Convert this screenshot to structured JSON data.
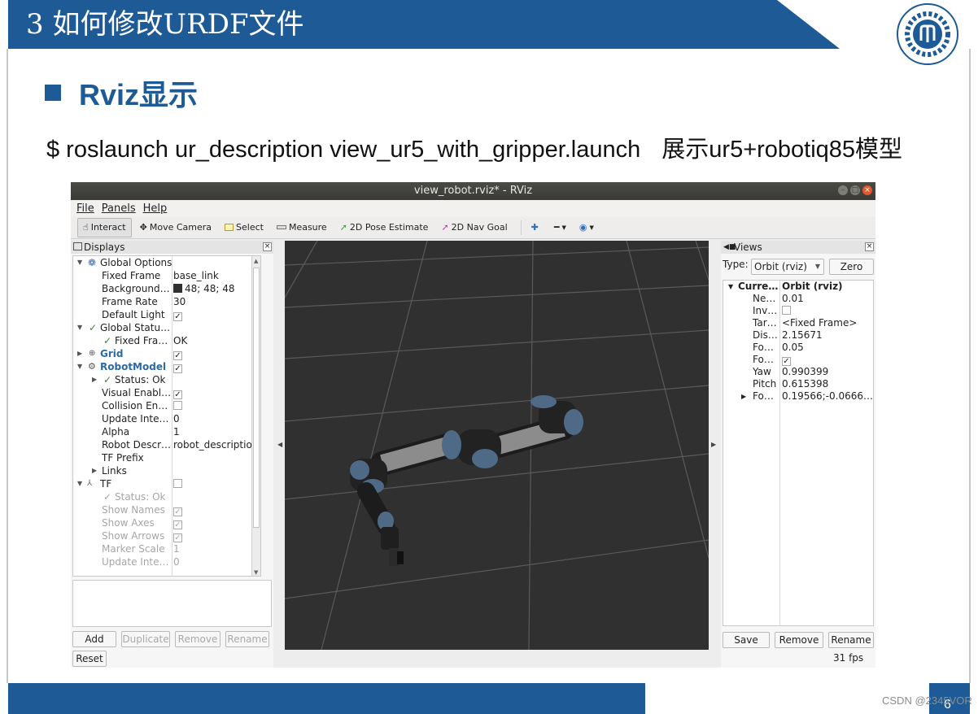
{
  "slide": {
    "title": "3 如何修改URDF文件",
    "section_heading": "Rviz显示",
    "command": "$ roslaunch ur_description view_ur5_with_gripper.launch",
    "command_desc": "展示ur5+robotiq85模型",
    "page_number": "6",
    "watermark": "CSDN @2345VOR",
    "colors": {
      "header_blue": "#1e5b96",
      "footer_blue": "#1e5b96",
      "viewport_bg": "#303030"
    }
  },
  "rviz": {
    "window_title": "view_robot.rviz* - RViz",
    "menu": [
      "File",
      "Panels",
      "Help"
    ],
    "toolbar": [
      {
        "label": "Interact",
        "icon": "hand-cursor-icon",
        "active": true
      },
      {
        "label": "Move Camera",
        "icon": "move-camera-icon",
        "active": false
      },
      {
        "label": "Select",
        "icon": "select-box-icon",
        "active": false
      },
      {
        "label": "Measure",
        "icon": "ruler-icon",
        "active": false
      },
      {
        "label": "2D Pose Estimate",
        "icon": "green-arrow-icon",
        "active": false
      },
      {
        "label": "2D Nav Goal",
        "icon": "magenta-arrow-icon",
        "active": false
      }
    ],
    "displays": {
      "title": "Displays",
      "rows": [
        {
          "name": "Global Options",
          "value": ""
        },
        {
          "name": "Fixed Frame",
          "value": "base_link"
        },
        {
          "name": "Background…",
          "value": "48; 48; 48"
        },
        {
          "name": "Frame Rate",
          "value": "30"
        },
        {
          "name": "Default Light",
          "value": ""
        },
        {
          "name": "Global Statu…",
          "value": ""
        },
        {
          "name": "Fixed Fra…",
          "value": "OK"
        },
        {
          "name": "Grid",
          "value": ""
        },
        {
          "name": "RobotModel",
          "value": ""
        },
        {
          "name": "Status: Ok",
          "value": ""
        },
        {
          "name": "Visual Enabl…",
          "value": ""
        },
        {
          "name": "Collision En…",
          "value": ""
        },
        {
          "name": "Update Inte…",
          "value": "0"
        },
        {
          "name": "Alpha",
          "value": "1"
        },
        {
          "name": "Robot Descr…",
          "value": "robot_description"
        },
        {
          "name": "TF Prefix",
          "value": ""
        },
        {
          "name": "Links",
          "value": ""
        },
        {
          "name": "TF",
          "value": ""
        },
        {
          "name": "Status: Ok",
          "value": ""
        },
        {
          "name": "Show Names",
          "value": ""
        },
        {
          "name": "Show Axes",
          "value": ""
        },
        {
          "name": "Show Arrows",
          "value": ""
        },
        {
          "name": "Marker Scale",
          "value": "1"
        },
        {
          "name": "Update Inte…",
          "value": "0"
        }
      ],
      "buttons": {
        "add": "Add",
        "duplicate": "Duplicate",
        "remove": "Remove",
        "rename": "Rename",
        "reset": "Reset"
      }
    },
    "views": {
      "title": "Views",
      "type_label": "Type:",
      "type_value": "Orbit (rviz)",
      "zero_label": "Zero",
      "rows": [
        {
          "name": "Curre…",
          "value": "Orbit (rviz)"
        },
        {
          "name": "Ne…",
          "value": "0.01"
        },
        {
          "name": "Inv…",
          "value": ""
        },
        {
          "name": "Tar…",
          "value": "<Fixed Frame>"
        },
        {
          "name": "Dis…",
          "value": "2.15671"
        },
        {
          "name": "Fo…",
          "value": "0.05"
        },
        {
          "name": "Fo…",
          "value": ""
        },
        {
          "name": "Yaw",
          "value": "0.990399"
        },
        {
          "name": "Pitch",
          "value": "0.615398"
        },
        {
          "name": "Fo…",
          "value": "0.19566;-0.0666…"
        }
      ],
      "buttons": {
        "save": "Save",
        "remove": "Remove",
        "rename": "Rename"
      }
    },
    "fps": "31 fps"
  }
}
